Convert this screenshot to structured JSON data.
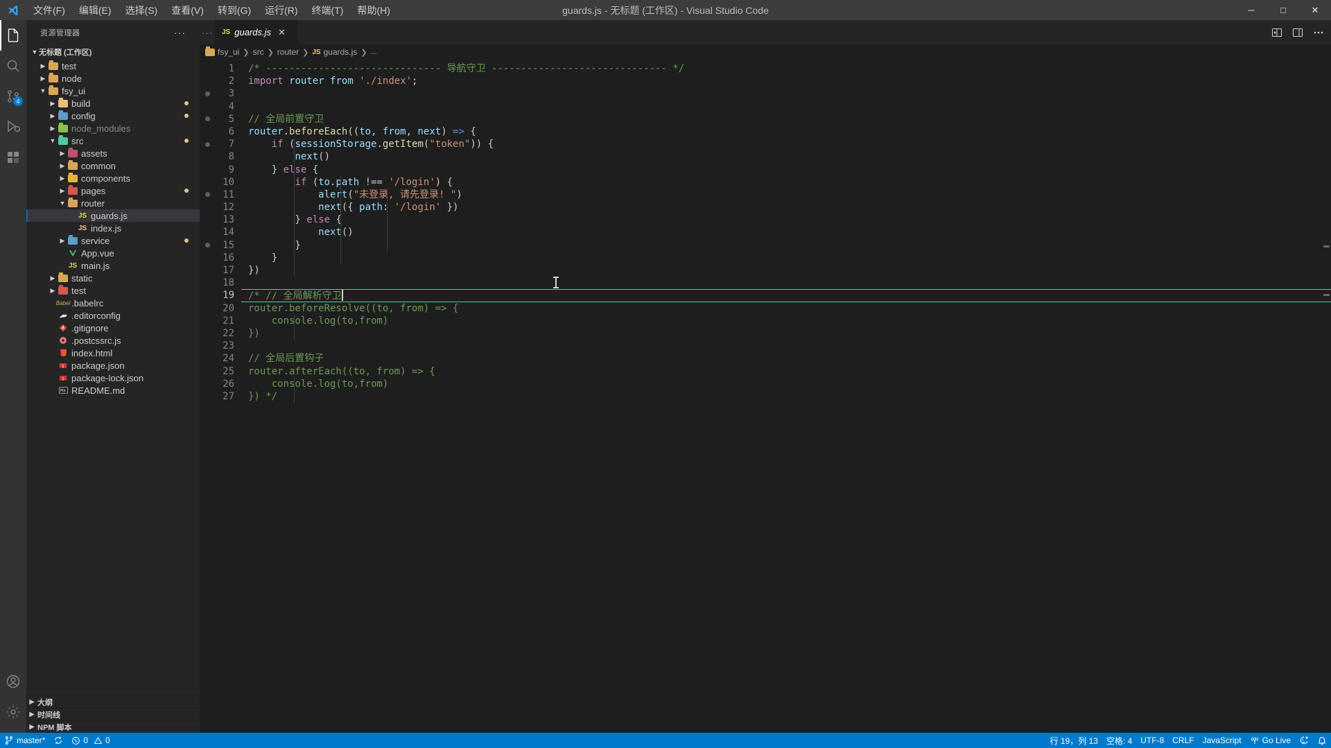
{
  "window": {
    "title": "guards.js - 无标题 (工作区) - Visual Studio Code",
    "minimize": "─",
    "maximize": "□",
    "close": "✕"
  },
  "menubar": {
    "logo": "vscode-logo-icon",
    "items": [
      {
        "label": "文件(F)",
        "name": "menu-file"
      },
      {
        "label": "编辑(E)",
        "name": "menu-edit"
      },
      {
        "label": "选择(S)",
        "name": "menu-selection"
      },
      {
        "label": "查看(V)",
        "name": "menu-view"
      },
      {
        "label": "转到(G)",
        "name": "menu-go"
      },
      {
        "label": "运行(R)",
        "name": "menu-run"
      },
      {
        "label": "终端(T)",
        "name": "menu-terminal"
      },
      {
        "label": "帮助(H)",
        "name": "menu-help"
      }
    ]
  },
  "activitybar": {
    "items": [
      {
        "icon": "files-explorer-icon",
        "active": true,
        "badge": ""
      },
      {
        "icon": "search-icon",
        "active": false,
        "badge": ""
      },
      {
        "icon": "source-control-icon",
        "active": false,
        "badge": "4"
      },
      {
        "icon": "run-debug-icon",
        "active": false,
        "badge": ""
      },
      {
        "icon": "extensions-icon",
        "active": false,
        "badge": ""
      }
    ],
    "bottom": [
      {
        "icon": "account-icon"
      },
      {
        "icon": "gear-icon"
      }
    ]
  },
  "sidebar": {
    "header": "资源管理器",
    "more": "···",
    "workspace": "无标题 (工作区)",
    "tree": [
      {
        "label": "test",
        "indent": 1,
        "type": "folder",
        "state": "collapsed",
        "color": "#d8a657",
        "dot": false
      },
      {
        "label": "node",
        "indent": 1,
        "type": "folder",
        "state": "collapsed",
        "color": "#d8a657",
        "dot": false
      },
      {
        "label": "fsy_ui",
        "indent": 1,
        "type": "folder",
        "state": "expanded",
        "color": "#d8a657",
        "dot": false
      },
      {
        "label": "build",
        "indent": 2,
        "type": "folder",
        "state": "collapsed",
        "color": "#e8c07a",
        "dot": true
      },
      {
        "label": "config",
        "indent": 2,
        "type": "folder",
        "state": "collapsed",
        "color": "#5a9ec9",
        "dot": true
      },
      {
        "label": "node_modules",
        "indent": 2,
        "type": "folder",
        "state": "collapsed",
        "color": "#8bc34a",
        "dot": false,
        "dim": true
      },
      {
        "label": "src",
        "indent": 2,
        "type": "folder",
        "state": "expanded",
        "color": "#4ec9a0",
        "dot": true
      },
      {
        "label": "assets",
        "indent": 3,
        "type": "folder",
        "state": "collapsed",
        "color": "#c2506a",
        "dot": false
      },
      {
        "label": "common",
        "indent": 3,
        "type": "folder",
        "state": "collapsed",
        "color": "#d8a657",
        "dot": false
      },
      {
        "label": "components",
        "indent": 3,
        "type": "folder",
        "state": "collapsed",
        "color": "#e3b341",
        "dot": false
      },
      {
        "label": "pages",
        "indent": 3,
        "type": "folder",
        "state": "collapsed",
        "color": "#d9554d",
        "dot": true
      },
      {
        "label": "router",
        "indent": 3,
        "type": "folder",
        "state": "expanded",
        "color": "#d8a657",
        "dot": false
      },
      {
        "label": "guards.js",
        "indent": 4,
        "type": "js",
        "state": "none",
        "color": "#e9d54a",
        "dot": false,
        "selected": true
      },
      {
        "label": "index.js",
        "indent": 4,
        "type": "js",
        "state": "none",
        "color": "#e9d54a",
        "dot": false
      },
      {
        "label": "service",
        "indent": 3,
        "type": "folder",
        "state": "collapsed",
        "color": "#5a9ec9",
        "dot": true
      },
      {
        "label": "App.vue",
        "indent": 3,
        "type": "vue",
        "state": "none",
        "color": "#41b883",
        "dot": false
      },
      {
        "label": "main.js",
        "indent": 3,
        "type": "js",
        "state": "none",
        "color": "#e9d54a",
        "dot": false
      },
      {
        "label": "static",
        "indent": 2,
        "type": "folder",
        "state": "collapsed",
        "color": "#d8a657",
        "dot": false
      },
      {
        "label": "test",
        "indent": 2,
        "type": "folder",
        "state": "collapsed",
        "color": "#d9554d",
        "dot": false
      },
      {
        "label": ".babelrc",
        "indent": 2,
        "type": "babel",
        "state": "none",
        "color": "#c9b458",
        "dot": false
      },
      {
        "label": ".editorconfig",
        "indent": 2,
        "type": "config",
        "state": "none",
        "color": "#e0e0e0",
        "dot": false
      },
      {
        "label": ".gitignore",
        "indent": 2,
        "type": "git",
        "state": "none",
        "color": "#e2574c",
        "dot": false
      },
      {
        "label": ".postcssrc.js",
        "indent": 2,
        "type": "postcss",
        "state": "none",
        "color": "#d87b7b",
        "dot": false
      },
      {
        "label": "index.html",
        "indent": 2,
        "type": "html",
        "state": "none",
        "color": "#e44d26",
        "dot": false
      },
      {
        "label": "package.json",
        "indent": 2,
        "type": "json",
        "state": "none",
        "color": "#cb3837",
        "dot": false
      },
      {
        "label": "package-lock.json",
        "indent": 2,
        "type": "json",
        "state": "none",
        "color": "#cb3837",
        "dot": false
      },
      {
        "label": "README.md",
        "indent": 2,
        "type": "md",
        "state": "none",
        "color": "#9e9e9e",
        "dot": false
      }
    ],
    "panels": [
      {
        "label": "大纲",
        "name": "panel-outline"
      },
      {
        "label": "时间线",
        "name": "panel-timeline"
      },
      {
        "label": "NPM 脚本",
        "name": "panel-npm-scripts"
      }
    ]
  },
  "editor": {
    "tabs": [
      {
        "label": "guards.js",
        "icon": "JS",
        "close": "✕",
        "active": true
      }
    ],
    "tab_overflow": "···",
    "actions": [
      "split-editor-icon",
      "layout-icon",
      "more-actions-icon"
    ],
    "breadcrumb": [
      "fsy_ui",
      "src",
      "router",
      "guards.js",
      "..."
    ],
    "breadcrumb_file_icon": "JS",
    "lines": [
      {
        "n": 1,
        "bp": false,
        "text": "/* ------------------------------ 导航守卫 ------------------------------ */"
      },
      {
        "n": 2,
        "bp": false,
        "text": "import router from './index';"
      },
      {
        "n": 3,
        "bp": true,
        "text": ""
      },
      {
        "n": 4,
        "bp": false,
        "text": ""
      },
      {
        "n": 5,
        "bp": true,
        "text": "// 全局前置守卫"
      },
      {
        "n": 6,
        "bp": false,
        "text": "router.beforeEach((to, from, next) => {"
      },
      {
        "n": 7,
        "bp": true,
        "text": "    if (sessionStorage.getItem(\"token\")) {"
      },
      {
        "n": 8,
        "bp": false,
        "text": "        next()"
      },
      {
        "n": 9,
        "bp": false,
        "text": "    } else {"
      },
      {
        "n": 10,
        "bp": false,
        "text": "        if (to.path !== '/login') {"
      },
      {
        "n": 11,
        "bp": true,
        "text": "            alert(\"未登录, 请先登录! \")"
      },
      {
        "n": 12,
        "bp": false,
        "text": "            next({ path: '/login' })"
      },
      {
        "n": 13,
        "bp": false,
        "text": "        } else {"
      },
      {
        "n": 14,
        "bp": false,
        "text": "            next()"
      },
      {
        "n": 15,
        "bp": true,
        "text": "        }"
      },
      {
        "n": 16,
        "bp": false,
        "text": "    }"
      },
      {
        "n": 17,
        "bp": false,
        "text": "})"
      },
      {
        "n": 18,
        "bp": false,
        "text": ""
      },
      {
        "n": 19,
        "bp": false,
        "text": "/* // 全局解析守卫",
        "current": true
      },
      {
        "n": 20,
        "bp": false,
        "text": "router.beforeResolve((to, from) => {"
      },
      {
        "n": 21,
        "bp": false,
        "text": "    console.log(to,from)"
      },
      {
        "n": 22,
        "bp": false,
        "text": "})"
      },
      {
        "n": 23,
        "bp": false,
        "text": ""
      },
      {
        "n": 24,
        "bp": false,
        "text": "// 全局后置钩子"
      },
      {
        "n": 25,
        "bp": false,
        "text": "router.afterEach((to, from) => {"
      },
      {
        "n": 26,
        "bp": false,
        "text": "    console.log(to,from)"
      },
      {
        "n": 27,
        "bp": false,
        "text": "}) */"
      }
    ]
  },
  "statusbar": {
    "left": [
      {
        "name": "branch-status",
        "icon": "source-control-icon",
        "label": "master*"
      },
      {
        "name": "sync-status",
        "icon": "sync-icon",
        "label": ""
      },
      {
        "name": "problems-status",
        "icon": "error-warning-icon",
        "label": "0  0",
        "errors": "0",
        "warnings": "0"
      }
    ],
    "right": [
      {
        "name": "cursor-position",
        "label": "行 19，列 13"
      },
      {
        "name": "indentation",
        "label": "空格: 4"
      },
      {
        "name": "encoding",
        "label": "UTF-8"
      },
      {
        "name": "eol",
        "label": "CRLF"
      },
      {
        "name": "language-mode",
        "label": "JavaScript"
      },
      {
        "name": "go-live",
        "label": "Go Live",
        "icon": "broadcast-icon"
      },
      {
        "name": "feedback",
        "label": "",
        "icon": "feedback-smiley-icon"
      },
      {
        "name": "notifications",
        "label": "",
        "icon": "bell-icon"
      }
    ]
  },
  "colors": {
    "accent": "#007acc",
    "titlebar_bg": "#3c3c3c",
    "sidebar_bg": "#252526",
    "editor_bg": "#1e1e1e",
    "current_line_border": "#3bd6a3",
    "selection_bg": "#37373d"
  }
}
